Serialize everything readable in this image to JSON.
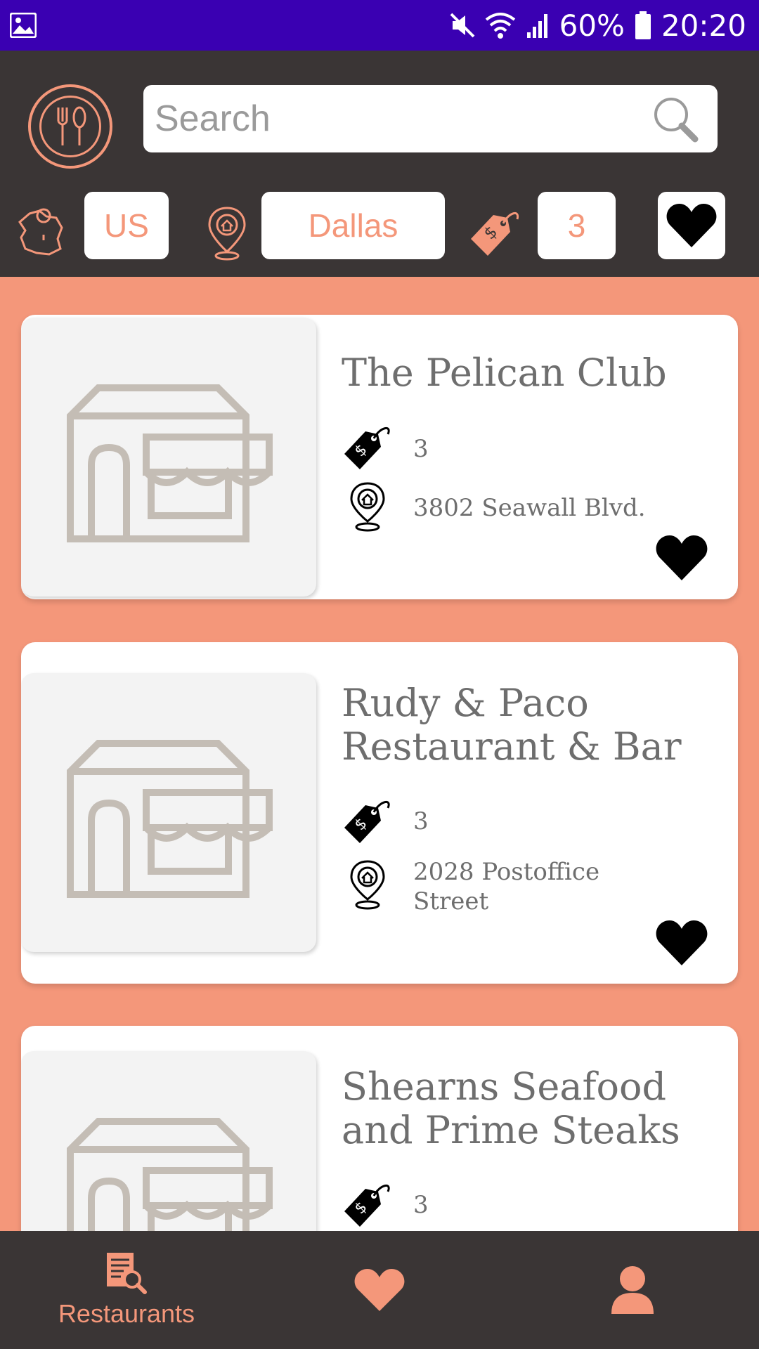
{
  "status_bar": {
    "battery": "60%",
    "time": "20:20"
  },
  "search": {
    "placeholder": "Search"
  },
  "filters": {
    "country": "US",
    "city": "Dallas",
    "price": "3"
  },
  "restaurants": [
    {
      "name": "The Pelican Club",
      "price": "3",
      "address": "3802 Seawall Blvd."
    },
    {
      "name": "Rudy & Paco Restaurant & Bar",
      "price": "3",
      "address": "2028 Postoffice Street"
    },
    {
      "name": "Shearns Seafood and Prime Steaks",
      "price": "3"
    }
  ],
  "nav": {
    "restaurants_label": "Restaurants"
  },
  "colors": {
    "accent": "#f4977a",
    "header": "#3a3535",
    "status_bar": "#3a00b2",
    "card_text": "#6e6e6e"
  }
}
